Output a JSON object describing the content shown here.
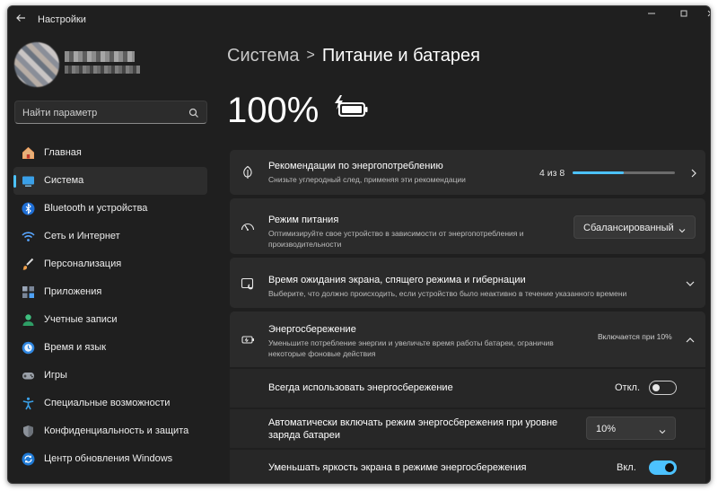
{
  "window": {
    "title": "Настройки",
    "controls": [
      "minimize-icon",
      "maximize-icon",
      "close-icon"
    ]
  },
  "search": {
    "placeholder": "Найти параметр"
  },
  "sidebar": {
    "items": [
      {
        "label": "Главная",
        "icon": "home-icon",
        "active": false
      },
      {
        "label": "Система",
        "icon": "system-icon",
        "active": true
      },
      {
        "label": "Bluetooth и устройства",
        "icon": "bluetooth-icon",
        "active": false
      },
      {
        "label": "Сеть и Интернет",
        "icon": "wifi-icon",
        "active": false
      },
      {
        "label": "Персонализация",
        "icon": "brush-icon",
        "active": false
      },
      {
        "label": "Приложения",
        "icon": "apps-icon",
        "active": false
      },
      {
        "label": "Учетные записи",
        "icon": "accounts-icon",
        "active": false
      },
      {
        "label": "Время и язык",
        "icon": "time-language-icon",
        "active": false
      },
      {
        "label": "Игры",
        "icon": "gamepad-icon",
        "active": false
      },
      {
        "label": "Специальные возможности",
        "icon": "accessibility-icon",
        "active": false
      },
      {
        "label": "Конфиденциальность и защита",
        "icon": "shield-icon",
        "active": false
      },
      {
        "label": "Центр обновления Windows",
        "icon": "update-icon",
        "active": false
      }
    ]
  },
  "breadcrumb": {
    "parent": "Система",
    "separator": ">",
    "current": "Питание и батарея"
  },
  "battery": {
    "percent": "100%",
    "icon": "battery-charging-icon"
  },
  "cards": {
    "recommendations": {
      "title": "Рекомендации по энергопотреблению",
      "subtitle": "Снизьте углеродный след, применяя эти рекомендации",
      "progress_text": "4 из 8",
      "progress_fraction": 0.5,
      "icon": "leaf-icon"
    },
    "power_mode": {
      "title": "Режим питания",
      "subtitle": "Оптимизируйте свое устройство в зависимости от энергопотребления и производительности",
      "value": "Сбалансированный",
      "icon": "gauge-icon"
    },
    "screen_timeout": {
      "title": "Время ожидания экрана, спящего режима и гибернации",
      "subtitle": "Выберите, что должно происходить, если устройство было неактивно в течение указанного времени",
      "icon": "screen-sleep-icon"
    },
    "battery_saver": {
      "title": "Энергосбережение",
      "subtitle": "Уменьшите потребление энергии и увеличьте время работы батареи, ограничив некоторые фоновые действия",
      "status": "Включается при 10%",
      "icon": "battery-saver-icon",
      "always_on": {
        "label": "Всегда использовать энергосбережение",
        "state_text": "Откл.",
        "on": false
      },
      "auto_on": {
        "label": "Автоматически включать режим энергосбережения при уровне заряда батареи",
        "value": "10%"
      },
      "lower_brightness": {
        "label": "Уменьшать яркость экрана в режиме энергосбережения",
        "state_text": "Вкл.",
        "on": true
      }
    }
  },
  "colors": {
    "accent": "#4cc2ff",
    "background": "#1f1f1f",
    "card": "#2b2b2b"
  }
}
